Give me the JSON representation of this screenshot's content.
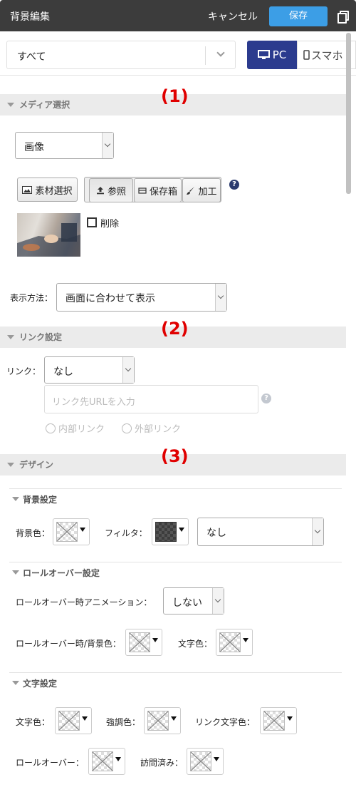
{
  "header": {
    "title": "背景編集",
    "cancel": "キャンセル",
    "save": "保存"
  },
  "topbar": {
    "scope_value": "すべて",
    "pc": "PC",
    "sp": "スマホ"
  },
  "annotations": [
    "(1)",
    "(2)",
    "(3)"
  ],
  "media": {
    "section_title": "メディア選択",
    "type_value": "画像",
    "btn_material": "素材選択",
    "btn_browse": "参照",
    "btn_storage": "保存箱",
    "btn_edit": "加工",
    "help": "?",
    "delete_label": "削除",
    "display_label": "表示方法：",
    "display_value": "画面に合わせて表示"
  },
  "link": {
    "section_title": "リンク設定",
    "link_label": "リンク：",
    "link_value": "なし",
    "url_placeholder": "リンク先URLを入力",
    "internal": "内部リンク",
    "external": "外部リンク"
  },
  "design": {
    "section_title": "デザイン",
    "bg": {
      "title": "背景設定",
      "bg_color": "背景色：",
      "filter": "フィルタ：",
      "filter_value": "なし"
    },
    "rollover": {
      "title": "ロールオーバー設定",
      "anim_label": "ロールオーバー時アニメーション：",
      "anim_value": "しない",
      "bg_label": "ロールオーバー時/背景色：",
      "text_color": "文字色："
    },
    "text": {
      "title": "文字設定",
      "text_color": "文字色：",
      "emphasis": "強調色：",
      "link_color": "リンク文字色：",
      "rollover": "ロールオーバー：",
      "visited": "訪問済み："
    }
  }
}
